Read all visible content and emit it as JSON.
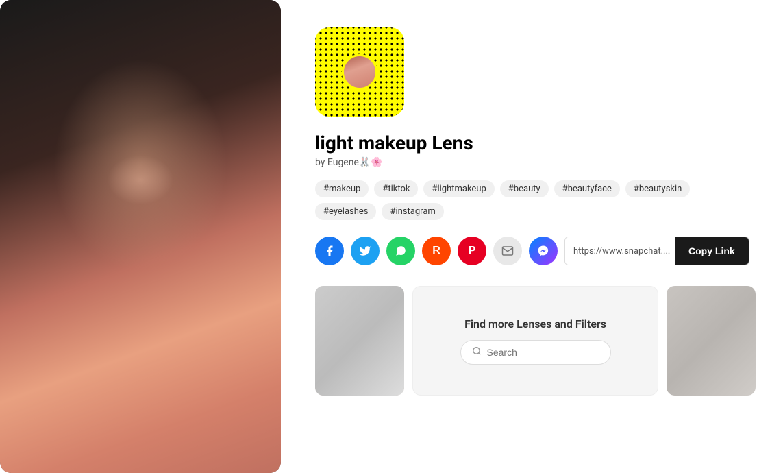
{
  "photo": {
    "alt": "Young woman with light makeup"
  },
  "snapcode": {
    "alt": "Snapchat lens QR code"
  },
  "lens": {
    "title": "light makeup Lens",
    "author": "by Eugene🐰🌸"
  },
  "tags": [
    {
      "id": "makeup",
      "label": "#makeup"
    },
    {
      "id": "tiktok",
      "label": "#tiktok"
    },
    {
      "id": "lightmakeup",
      "label": "#lightmakeup"
    },
    {
      "id": "beauty",
      "label": "#beauty"
    },
    {
      "id": "beautyface",
      "label": "#beautyface"
    },
    {
      "id": "beautyskin",
      "label": "#beautyskin"
    },
    {
      "id": "eyelashes",
      "label": "#eyelashes"
    },
    {
      "id": "instagram",
      "label": "#instagram"
    }
  ],
  "share": {
    "facebook_icon": "f",
    "twitter_icon": "t",
    "whatsapp_icon": "w",
    "reddit_icon": "r",
    "pinterest_icon": "p",
    "email_icon": "✉",
    "messenger_icon": "m",
    "link_url": "https://www.snapchat....",
    "copy_label": "Copy Link"
  },
  "discover": {
    "title": "Find more Lenses and Filters",
    "search_placeholder": "Search"
  }
}
